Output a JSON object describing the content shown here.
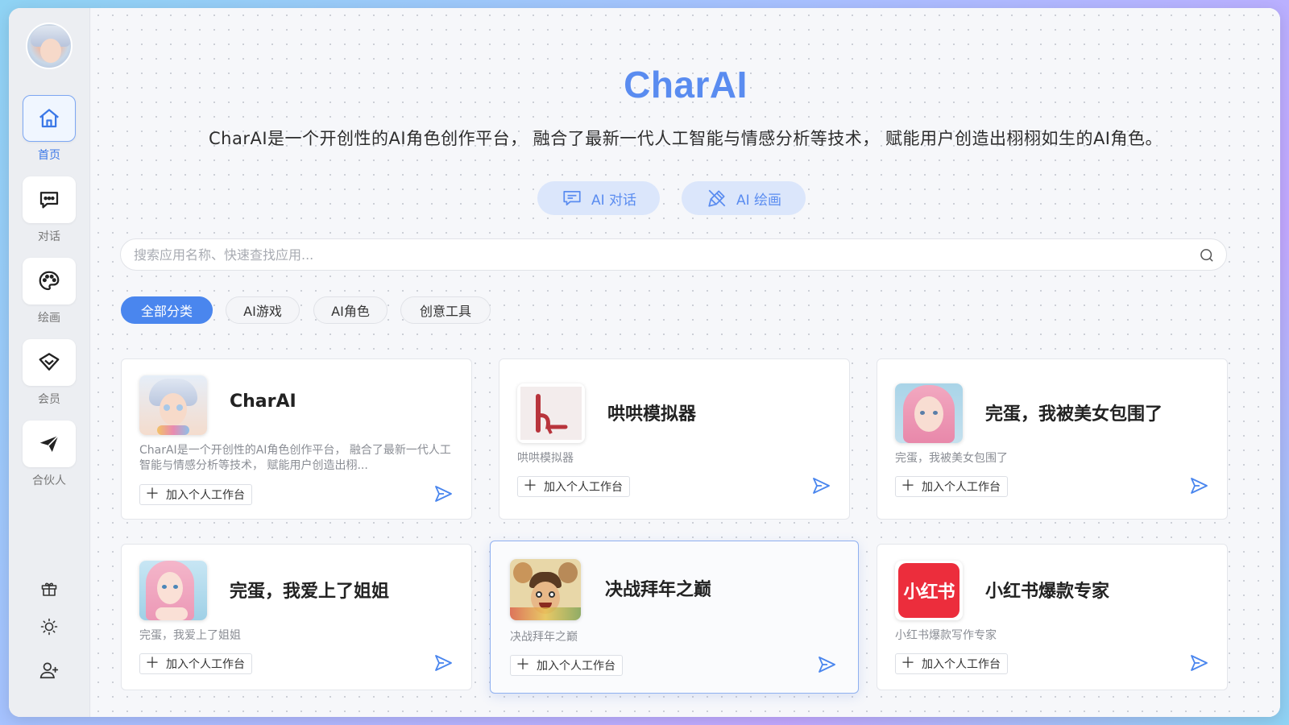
{
  "app": {
    "title": "CharAI",
    "subtitle": "CharAI是一个开创性的AI角色创作平台， 融合了最新一代人工智能与情感分析等技术， 赋能用户创造出栩栩如生的AI角色。"
  },
  "sidebar": {
    "items": [
      {
        "label": "首页",
        "icon": "home-icon",
        "active": true
      },
      {
        "label": "对话",
        "icon": "chat-icon"
      },
      {
        "label": "绘画",
        "icon": "palette-icon"
      },
      {
        "label": "会员",
        "icon": "diamond-icon"
      },
      {
        "label": "合伙人",
        "icon": "send-icon"
      }
    ],
    "tools": [
      "gift-icon",
      "sun-icon",
      "user-icon"
    ]
  },
  "quick_actions": [
    {
      "label": "AI 对话",
      "icon": "chat-icon"
    },
    {
      "label": "AI 绘画",
      "icon": "brush-icon"
    }
  ],
  "search": {
    "placeholder": "搜索应用名称、快速查找应用..."
  },
  "categories": [
    {
      "label": "全部分类",
      "active": true
    },
    {
      "label": "AI游戏"
    },
    {
      "label": "AI角色"
    },
    {
      "label": "创意工具"
    }
  ],
  "cards": [
    {
      "title": "CharAI",
      "desc": "CharAI是一个开创性的AI角色创作平台， 融合了最新一代人工智能与情感分析等技术， 赋能用户创造出栩...",
      "add_label": "加入个人工作台"
    },
    {
      "title": "哄哄模拟器",
      "desc": "哄哄模拟器",
      "add_label": "加入个人工作台"
    },
    {
      "title": "完蛋，我被美女包围了",
      "desc": "完蛋，我被美女包围了",
      "add_label": "加入个人工作台"
    },
    {
      "title": "完蛋，我爱上了姐姐",
      "desc": "完蛋，我爱上了姐姐",
      "add_label": "加入个人工作台"
    },
    {
      "title": "决战拜年之巅",
      "desc": "决战拜年之巅",
      "add_label": "加入个人工作台"
    },
    {
      "title": "小红书爆款专家",
      "desc": "小红书爆款写作专家",
      "add_label": "加入个人工作台",
      "logo_text": "小红书"
    }
  ],
  "colors": {
    "accent": "#4a86ee",
    "title": "#5a8cf0",
    "quick_bg": "#dbe6fb",
    "xhs_red": "#ec2d3c"
  }
}
